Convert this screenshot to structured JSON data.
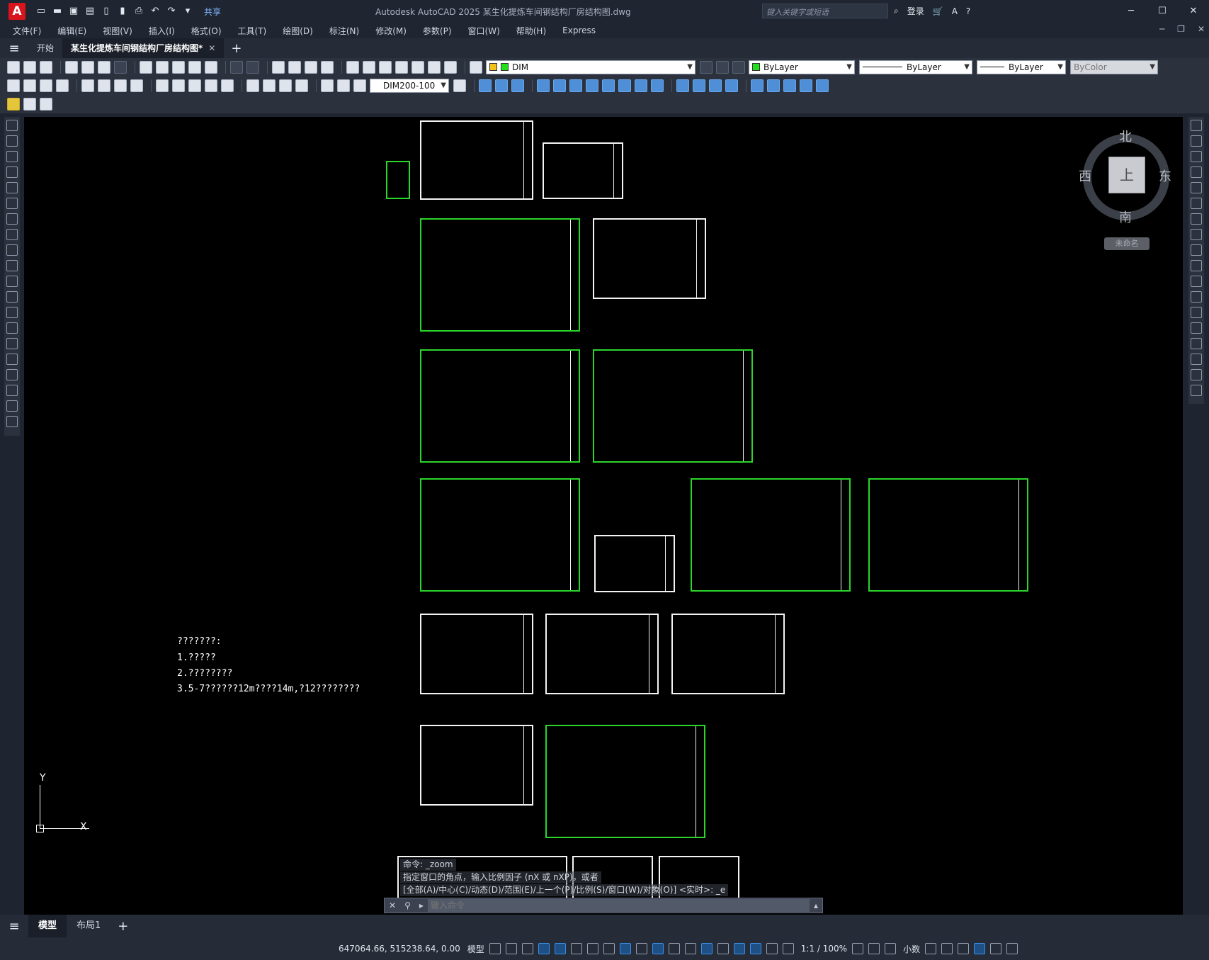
{
  "app": {
    "logo": "A",
    "title": "Autodesk AutoCAD 2025    某生化提炼车间钢结构厂房结构图.dwg",
    "share": "共享",
    "search_placeholder": "键入关键字或短语",
    "login": "登录",
    "accent": "#d8141d"
  },
  "menu": [
    "文件(F)",
    "编辑(E)",
    "视图(V)",
    "插入(I)",
    "格式(O)",
    "工具(T)",
    "绘图(D)",
    "标注(N)",
    "修改(M)",
    "参数(P)",
    "窗口(W)",
    "帮助(H)",
    "Express"
  ],
  "tabs": {
    "start": "开始",
    "active": "某生化提炼车间钢结构厂房结构图*"
  },
  "toolbar": {
    "layer": "DIM",
    "color": "ByLayer",
    "linetype": "ByLayer",
    "lineweight": "ByLayer",
    "plotstyle": "ByColor",
    "dimstyle": "DIM200-100",
    "layer_color": "#22e01b"
  },
  "viewcube": {
    "north": "北",
    "south": "南",
    "east": "东",
    "west": "西",
    "face": "上",
    "wcs": "未命名"
  },
  "ucs": {
    "x": "X",
    "y": "Y"
  },
  "notes": [
    "???????:",
    "1.?????",
    "2.????????",
    "3.5-7??????12m????14m,?12????????"
  ],
  "command": {
    "history": [
      "命令: _zoom",
      "指定窗口的角点，输入比例因子 (nX 或 nXP)，或者",
      "[全部(A)/中心(C)/动态(D)/范围(E)/上一个(P)/比例(S)/窗口(W)/对象(O)] <实时>: _e"
    ],
    "placeholder": "键入命令"
  },
  "layouts": [
    "模型",
    "布局1"
  ],
  "status": {
    "coords": "647064.66, 515238.64, 0.00",
    "model": "模型",
    "scale": "1:1 / 100%",
    "units": "小数"
  }
}
